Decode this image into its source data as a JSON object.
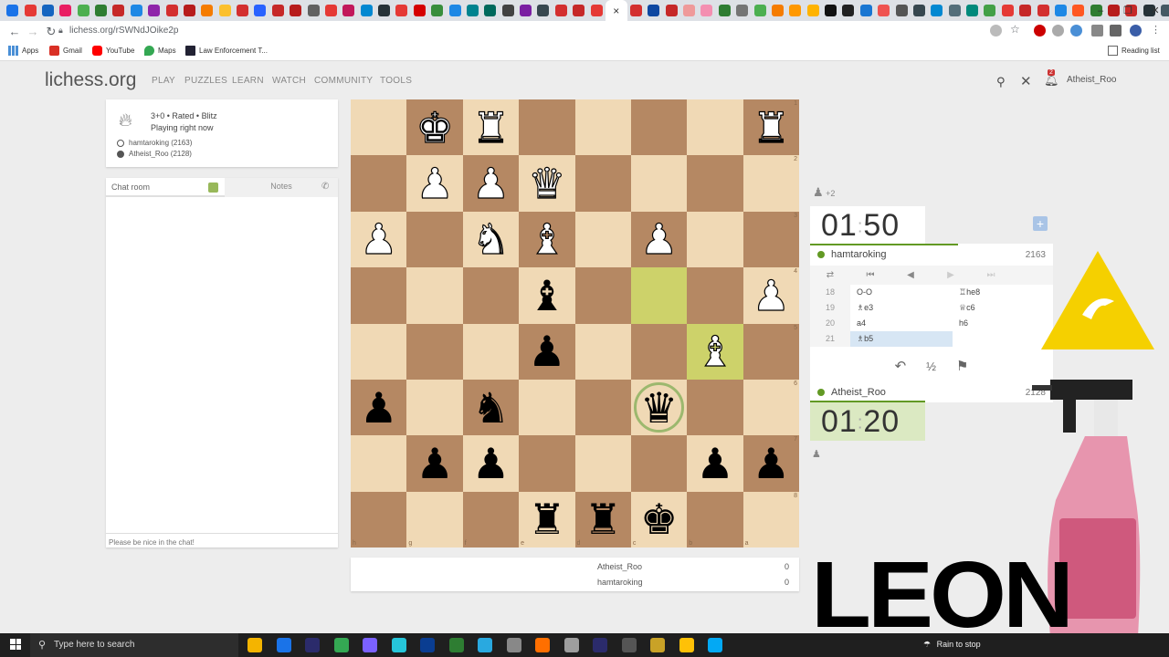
{
  "browser": {
    "new_tab": "+",
    "active_tab_close": "×",
    "window_controls": [
      "–",
      "❐",
      "✕"
    ],
    "url": "lichess.org/rSWNdJOike2p",
    "bookmarks": {
      "apps": "Apps",
      "gmail": "Gmail",
      "youtube": "YouTube",
      "maps": "Maps",
      "law": "Law Enforcement T...",
      "reading_list": "Reading list"
    }
  },
  "site": {
    "logo": "lichess.org",
    "nav": [
      "PLAY",
      "PUZZLES",
      "LEARN",
      "WATCH",
      "COMMUNITY",
      "TOOLS"
    ],
    "notification_count": "2",
    "username": "Atheist_Roo"
  },
  "game_info": {
    "line1": "3+0 • Rated • Blitz",
    "line2": "Playing right now",
    "white_player": "hamtaroking (2163)",
    "black_player": "Atheist_Roo (2128)"
  },
  "chat": {
    "tab_room": "Chat room",
    "tab_notes": "Notes",
    "placeholder": "Please be nice in the chat!"
  },
  "board": {
    "rank_labels": [
      "1",
      "2",
      "3",
      "4",
      "5",
      "6",
      "7",
      "8"
    ],
    "file_labels": [
      "h",
      "g",
      "f",
      "e",
      "d",
      "c",
      "b",
      "a"
    ],
    "rows": [
      [
        "",
        "wK",
        "wR",
        "",
        "",
        "",
        "",
        "wR"
      ],
      [
        "",
        "wP",
        "wP",
        "wQ",
        "",
        "",
        "",
        ""
      ],
      [
        "wP",
        "",
        "wN",
        "wB",
        "",
        "wP",
        "",
        ""
      ],
      [
        "",
        "",
        "",
        "bB",
        "",
        "",
        "",
        "wP"
      ],
      [
        "",
        "",
        "",
        "bP",
        "",
        "",
        "wB",
        ""
      ],
      [
        "bP",
        "",
        "bN",
        "",
        "",
        "bQ",
        "",
        ""
      ],
      [
        "",
        "bP",
        "bP",
        "",
        "",
        "",
        "bP",
        "bP"
      ],
      [
        "",
        "",
        "",
        "bR",
        "bR",
        "bK",
        "",
        ""
      ]
    ],
    "highlighted": [
      "3-5",
      "4-6"
    ],
    "check_square": "5-5"
  },
  "score_panel": {
    "rows": [
      {
        "name": "Atheist_Roo",
        "score": "0"
      },
      {
        "name": "hamtaroking",
        "score": "0"
      }
    ]
  },
  "right_panel": {
    "opponent_extra": "+2",
    "top_clock": {
      "min": "01",
      "sec": "50"
    },
    "top_clock_progress": 0.61,
    "bottom_clock": {
      "min": "01",
      "sec": "20"
    },
    "plus_button": "+",
    "top_player": {
      "name": "hamtaroking",
      "rating": "2163"
    },
    "bottom_player": {
      "name": "Atheist_Roo",
      "rating": "2128"
    },
    "moves": [
      {
        "num": "18",
        "white": "O-O",
        "black": "♖he8"
      },
      {
        "num": "19",
        "white": "♗e3",
        "black": "♕c6"
      },
      {
        "num": "20",
        "white": "a4",
        "black": "h6"
      },
      {
        "num": "21",
        "white": "♗b5",
        "black": ""
      }
    ],
    "controls": {
      "takeback": "↶",
      "draw": "½",
      "resign": "⚑"
    },
    "nav_icons": [
      "⇄",
      "⏮",
      "◀",
      "▶",
      "⏭"
    ]
  },
  "overlay": {
    "leon_text": "LEON"
  },
  "taskbar": {
    "search_placeholder": "Type here to search",
    "weather": "Rain to stop",
    "weather_icon": "umbrella-icon"
  }
}
